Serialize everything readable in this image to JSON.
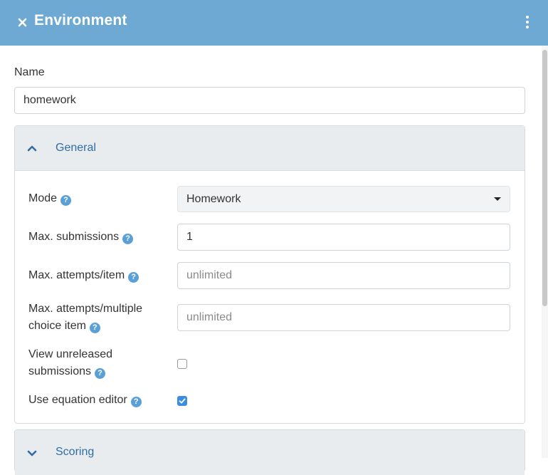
{
  "header": {
    "title": "Environment",
    "close_icon": "close-icon",
    "menu_icon": "kebab-menu-icon",
    "background_color": "#6ea9d3"
  },
  "name_field": {
    "label": "Name",
    "value": "homework"
  },
  "general_panel": {
    "title": "General",
    "expanded": true,
    "fields": {
      "mode": {
        "label": "Mode",
        "value": "Homework"
      },
      "max_submissions": {
        "label": "Max. submissions",
        "value": "1"
      },
      "max_attempts_item": {
        "label": "Max. attempts/item",
        "value": "",
        "placeholder": "unlimited"
      },
      "max_attempts_mc_line1": "Max. attempts/multiple",
      "max_attempts_mc_line2": "choice item",
      "max_attempts_mc": {
        "value": "",
        "placeholder": "unlimited"
      },
      "view_unreleased_line1": "View unreleased",
      "view_unreleased_line2": "submissions",
      "view_unreleased": {
        "checked": false
      },
      "equation_editor": {
        "label": "Use equation editor",
        "checked": true
      }
    }
  },
  "scoring_panel": {
    "title": "Scoring",
    "expanded": false
  },
  "help_glyph": "?",
  "colors": {
    "accent": "#3b8de0",
    "link": "#2f6ea5",
    "help": "#5aa0d6"
  }
}
